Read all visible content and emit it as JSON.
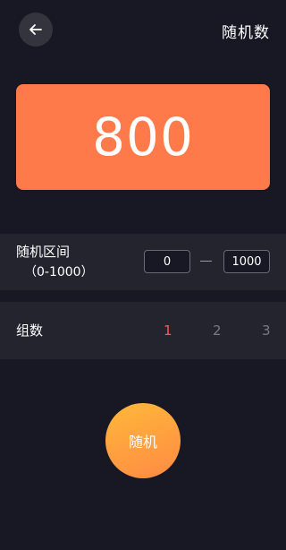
{
  "header": {
    "back_icon": "arrow-left-icon",
    "title": "随机数"
  },
  "result": {
    "value": "800",
    "color": "#ff7a4a"
  },
  "range": {
    "label": "随机区间",
    "hint": "（0-1000）",
    "min_value": "0",
    "max_value": "1000"
  },
  "groups": {
    "label": "组数",
    "options": [
      "1",
      "2",
      "3"
    ],
    "selected": "1",
    "active_color": "#ff5a44"
  },
  "action": {
    "label": "随机"
  }
}
